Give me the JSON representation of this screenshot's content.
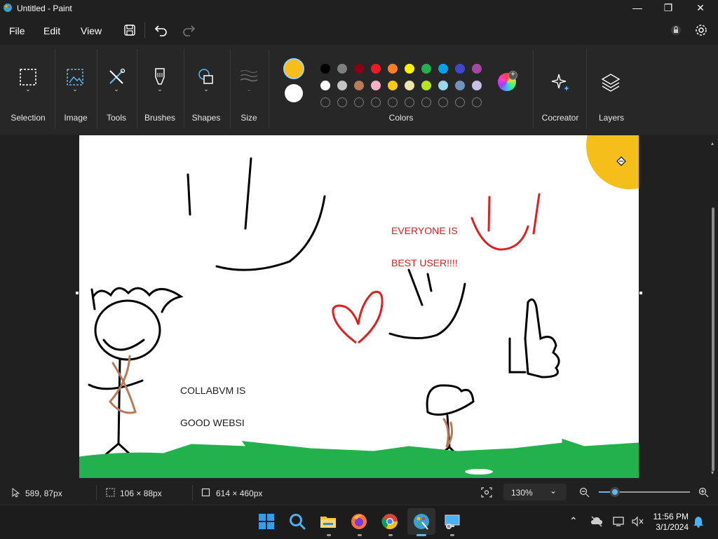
{
  "window": {
    "title": "Untitled - Paint",
    "minimize": "—",
    "maximize": "❐",
    "close": "✕"
  },
  "menu": {
    "file": "File",
    "edit": "Edit",
    "view": "View"
  },
  "ribbon": {
    "groups": {
      "selection": "Selection",
      "image": "Image",
      "tools": "Tools",
      "brushes": "Brushes",
      "shapes": "Shapes",
      "size": "Size",
      "colors": "Colors",
      "cocreator": "Cocreator",
      "layers": "Layers"
    },
    "primary_color": "#f6be1a",
    "secondary_color": "#ffffff",
    "palette_row1": [
      "#000000",
      "#7f7f7f",
      "#880015",
      "#ed1c24",
      "#ff7f27",
      "#fff200",
      "#22b14c",
      "#00a2e8",
      "#3f48cc",
      "#a349a4"
    ],
    "palette_row2": [
      "#ffffff",
      "#c3c3c3",
      "#b97a57",
      "#ffaec9",
      "#ffc90e",
      "#efe4b0",
      "#b5e61d",
      "#99d9ea",
      "#7092be",
      "#c8bfe7"
    ],
    "custom_slots": 10
  },
  "canvas": {
    "text1_line1": "EVERYONE IS",
    "text1_line2": "BEST USER!!!!",
    "text2_line1": "COLLABVM IS",
    "text2_line2": "GOOD WEBSI",
    "text1_color": "#e02020",
    "text2_color": "#202020"
  },
  "status": {
    "cursor_pos": "589, 87px",
    "selection_size": "106 × 88px",
    "canvas_size": "614 × 460px",
    "zoom": "130%",
    "zoom_level_fraction": 0.18
  },
  "taskbar": {
    "apps": [
      "start-icon",
      "search-icon",
      "file-explorer-icon",
      "firefox-icon",
      "chrome-icon",
      "paint-icon",
      "remote-desktop-icon"
    ],
    "time": "11:56 PM",
    "date": "3/1/2024"
  }
}
